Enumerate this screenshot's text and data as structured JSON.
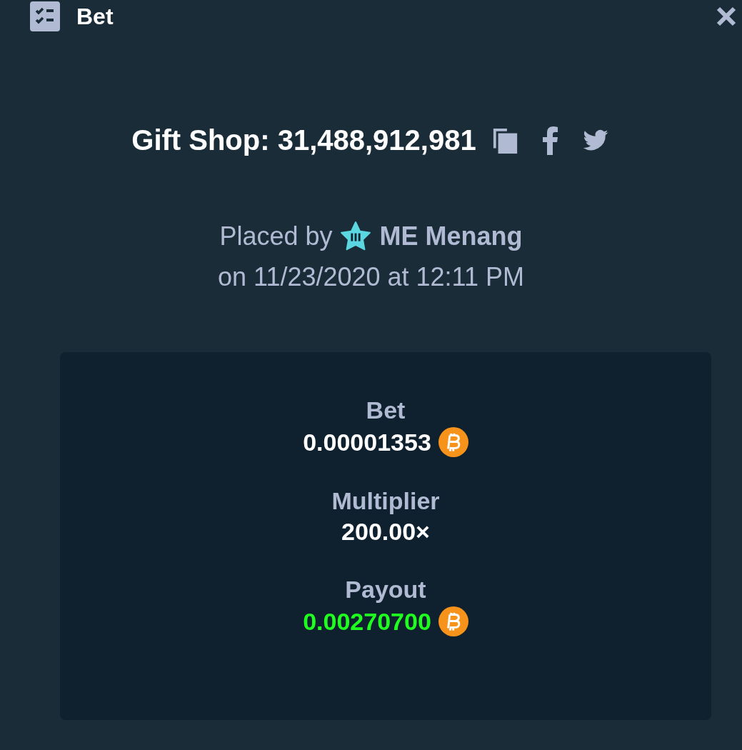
{
  "header": {
    "title": "Bet"
  },
  "game": {
    "title": "Gift Shop: 31,488,912,981"
  },
  "placed": {
    "prefix": "Placed by",
    "user": "ME Menang",
    "date": "on 11/23/2020 at 12:11 PM"
  },
  "stats": [
    {
      "label": "Bet",
      "value": "0.00001353",
      "coin": true,
      "win": false
    },
    {
      "label": "Multiplier",
      "value": "200.00×",
      "coin": false,
      "win": false
    },
    {
      "label": "Payout",
      "value": "0.00270700",
      "coin": true,
      "win": true
    }
  ]
}
